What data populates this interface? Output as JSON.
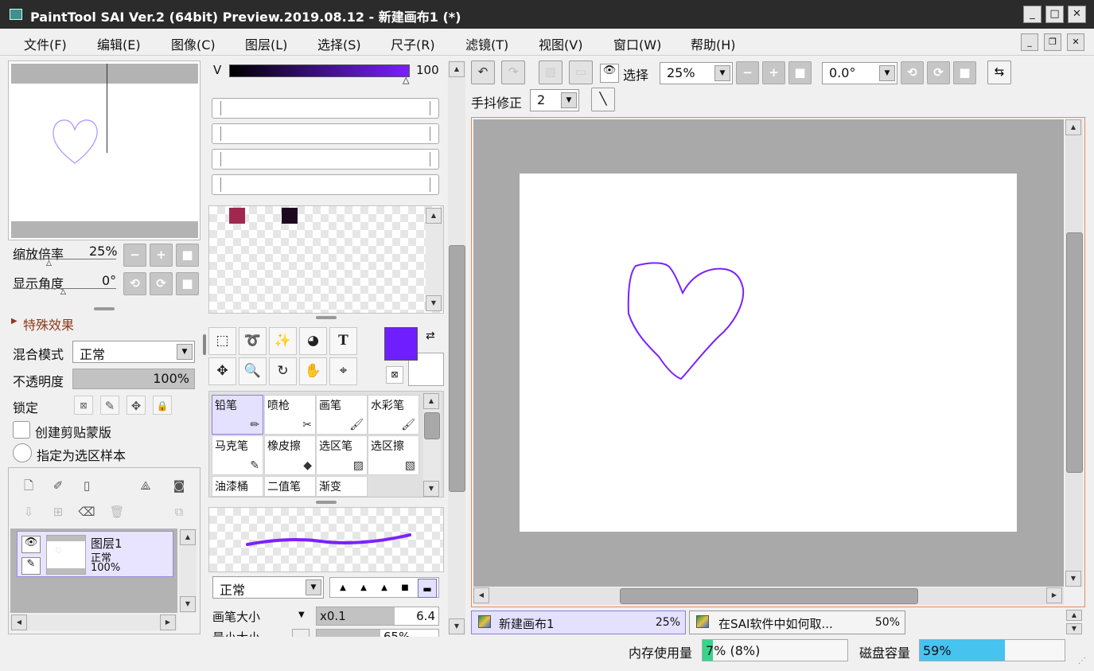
{
  "app": {
    "title": "PaintTool SAI Ver.2 (64bit) Preview.2019.08.12 - 新建画布1 (*)"
  },
  "window_buttons": {
    "minimize": "_",
    "maximize": "□",
    "close": "✕"
  },
  "menu": [
    "文件(F)",
    "编辑(E)",
    "图像(C)",
    "图层(L)",
    "选择(S)",
    "尺子(R)",
    "滤镜(T)",
    "视图(V)",
    "窗口(W)",
    "帮助(H)"
  ],
  "navigator": {
    "zoom_label": "缩放倍率",
    "zoom_value": "25%",
    "angle_label": "显示角度",
    "angle_value": "0°"
  },
  "effects": {
    "label": "特殊效果"
  },
  "layer_props": {
    "blend_label": "混合模式",
    "blend_value": "正常",
    "opacity_label": "不透明度",
    "opacity_value": "100%",
    "opacity_fraction": 1.0,
    "lock_label": "锁定",
    "clip_label": "创建剪贴蒙版",
    "sample_label": "指定为选区样本"
  },
  "layers": [
    {
      "name": "图层1",
      "mode": "正常",
      "opacity": "100%"
    }
  ],
  "color": {
    "v_label": "V",
    "v_value": "100",
    "swatches": [
      "#a0284e",
      "#1e0820"
    ],
    "primary": "#6f1fff",
    "secondary": "#ffffff"
  },
  "tools": {
    "text_icon": "T"
  },
  "brushes": [
    "铅笔",
    "喷枪",
    "画笔",
    "水彩笔",
    "马克笔",
    "橡皮擦",
    "选区笔",
    "选区擦",
    "油漆桶",
    "二值笔",
    "渐变"
  ],
  "brush_settings": {
    "mode_value": "正常",
    "size_label": "画笔大小",
    "size_mult": "x0.1",
    "size_value": "6.4",
    "min_size_label": "最小大小",
    "min_size_value": "65%"
  },
  "canvas_toolbar": {
    "select_label": "选择",
    "zoom_value": "25%",
    "angle_value": "0.0°",
    "stabilizer_label": "手抖修正",
    "stabilizer_value": "2"
  },
  "stroke_color": "#7a22ff",
  "tabs": [
    {
      "label": "新建画布1",
      "zoom": "25%"
    },
    {
      "label": "在SAI软件中如何取...",
      "zoom": "50%"
    }
  ],
  "status": {
    "memory_label": "内存使用量",
    "memory_value": "7% (8%)",
    "memory_fraction": 0.07,
    "disk_label": "磁盘容量",
    "disk_value": "59%",
    "disk_fraction": 0.59
  }
}
